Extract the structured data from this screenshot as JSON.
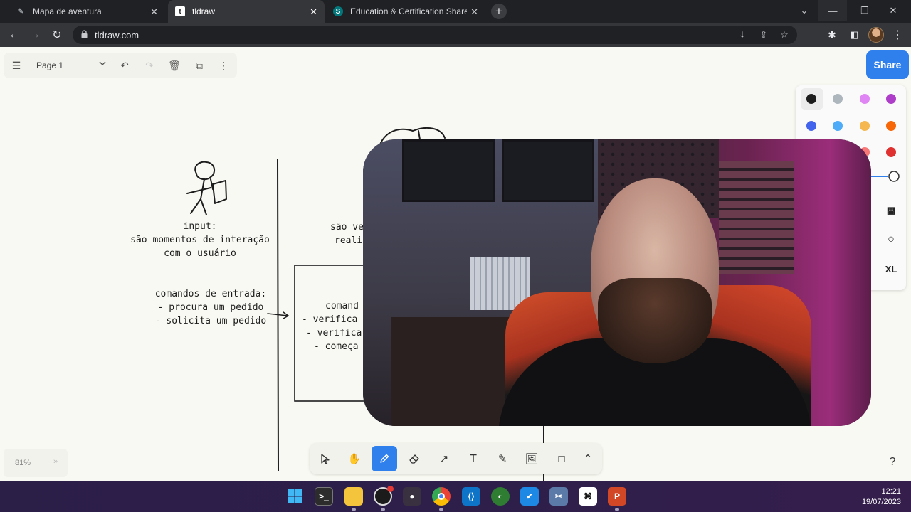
{
  "browser": {
    "tabs": [
      {
        "title": "Mapa de aventura",
        "favicon": "pencil-favicon",
        "active": false
      },
      {
        "title": "tldraw",
        "favicon": "tldraw-favicon",
        "active": true
      },
      {
        "title": "Education & Certification Shared",
        "favicon": "sharepoint-favicon",
        "active": false
      }
    ],
    "url": "tldraw.com",
    "new_tab": "+"
  },
  "tldraw": {
    "page_name": "Page 1",
    "share_label": "Share",
    "size_label": "XL",
    "zoom": "81%",
    "help": "?",
    "colors": [
      "#1d1d1d",
      "#adb5bd",
      "#e085f4",
      "#ae3ec9",
      "#4263eb",
      "#4dabf7",
      "#f5b750",
      "#f76707",
      "#ffffff",
      "#ffffff",
      "#f87777",
      "#e03131"
    ],
    "toolbar_tools": [
      "select-tool",
      "hand-tool",
      "draw-tool",
      "eraser-tool",
      "arrow-tool",
      "text-tool",
      "note-tool",
      "image-tool",
      "rectangle-tool",
      "more-tools"
    ],
    "active_tool": "draw-tool"
  },
  "canvas": {
    "input_title": "input:",
    "input_line1": "são momentos de interação",
    "input_line2": "com o usuário",
    "commands_title": "comandos de entrada:",
    "commands_item1": "- procura um pedido",
    "commands_item2": "- solicita um pedido",
    "box_title": "comand",
    "box_item1": "- verifica se",
    "box_item2": "- verifica s",
    "box_item3": "- começa",
    "middle_line1": "são ve",
    "middle_line2": "realiz"
  },
  "taskbar": {
    "time": "12:21",
    "date": "19/07/2023",
    "apps": [
      "windows-start",
      "terminal",
      "file-explorer",
      "obs",
      "camera",
      "chrome",
      "vscode",
      "app-green",
      "todo",
      "snipping-tool",
      "capcut",
      "powerpoint"
    ]
  }
}
